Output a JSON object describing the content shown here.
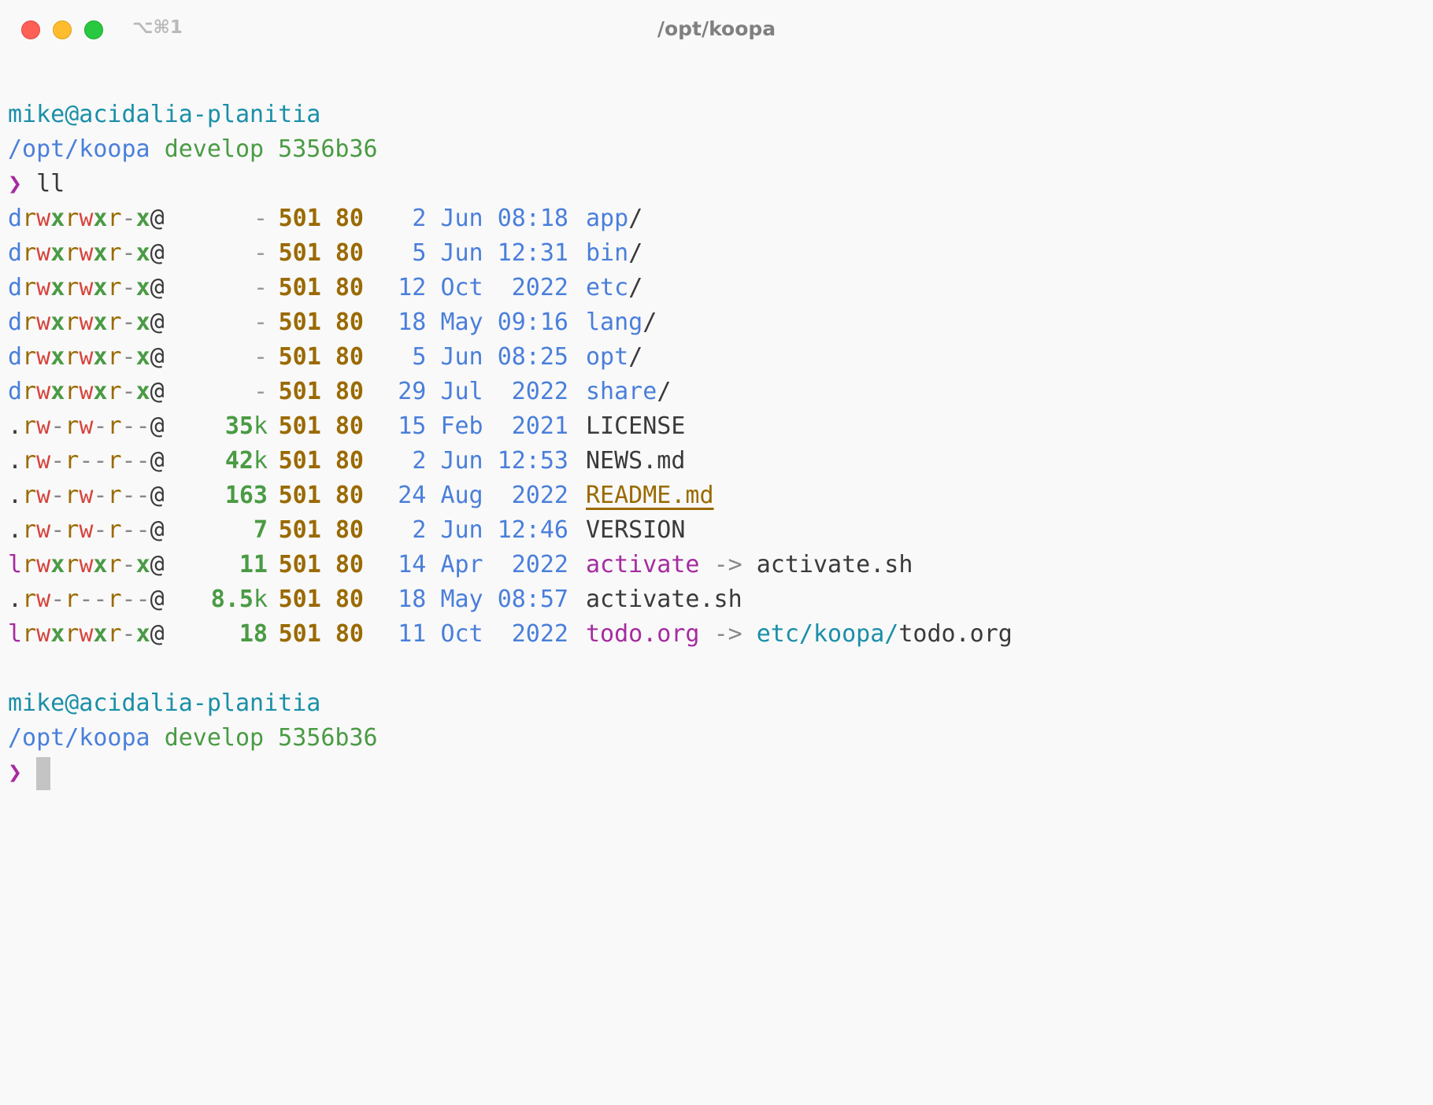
{
  "window": {
    "title": "/opt/koopa",
    "shortcut": "⌥⌘1"
  },
  "colors": {
    "background": "#f9f9f9",
    "text": "#3a3a3a",
    "blue": "#4a7fdb",
    "cyan": "#1a8fa8",
    "green": "#4a9b44",
    "yellow": "#9a6a00",
    "red": "#d6443d",
    "magenta": "#a62ba0"
  },
  "prompt1": {
    "user": "mike@acidalia-planitia",
    "cwd": "/opt/koopa",
    "branch": "develop 5356b36",
    "chevron": "❯",
    "command": "ll"
  },
  "listing": [
    {
      "perm": "drwxrwxr-x@",
      "size": "-",
      "user": "501",
      "group": "80",
      "day": "2",
      "month": "Jun",
      "timeyear": "08:18",
      "name": "app",
      "suffix": "/",
      "kind": "dir"
    },
    {
      "perm": "drwxrwxr-x@",
      "size": "-",
      "user": "501",
      "group": "80",
      "day": "5",
      "month": "Jun",
      "timeyear": "12:31",
      "name": "bin",
      "suffix": "/",
      "kind": "dir"
    },
    {
      "perm": "drwxrwxr-x@",
      "size": "-",
      "user": "501",
      "group": "80",
      "day": "12",
      "month": "Oct",
      "timeyear": "2022",
      "name": "etc",
      "suffix": "/",
      "kind": "dir"
    },
    {
      "perm": "drwxrwxr-x@",
      "size": "-",
      "user": "501",
      "group": "80",
      "day": "18",
      "month": "May",
      "timeyear": "09:16",
      "name": "lang",
      "suffix": "/",
      "kind": "dir"
    },
    {
      "perm": "drwxrwxr-x@",
      "size": "-",
      "user": "501",
      "group": "80",
      "day": "5",
      "month": "Jun",
      "timeyear": "08:25",
      "name": "opt",
      "suffix": "/",
      "kind": "dir"
    },
    {
      "perm": "drwxrwxr-x@",
      "size": "-",
      "user": "501",
      "group": "80",
      "day": "29",
      "month": "Jul",
      "timeyear": "2022",
      "name": "share",
      "suffix": "/",
      "kind": "dir"
    },
    {
      "perm": ".rw-rw-r--@",
      "size": "35k",
      "user": "501",
      "group": "80",
      "day": "15",
      "month": "Feb",
      "timeyear": "2021",
      "name": "LICENSE",
      "kind": "file"
    },
    {
      "perm": ".rw-r--r--@",
      "size": "42k",
      "user": "501",
      "group": "80",
      "day": "2",
      "month": "Jun",
      "timeyear": "12:53",
      "name": "NEWS.md",
      "kind": "file"
    },
    {
      "perm": ".rw-rw-r--@",
      "size": "163",
      "user": "501",
      "group": "80",
      "day": "24",
      "month": "Aug",
      "timeyear": "2022",
      "name": "README.md",
      "kind": "readme"
    },
    {
      "perm": ".rw-rw-r--@",
      "size": "7",
      "user": "501",
      "group": "80",
      "day": "2",
      "month": "Jun",
      "timeyear": "12:46",
      "name": "VERSION",
      "kind": "file"
    },
    {
      "perm": "lrwxrwxr-x@",
      "size": "11",
      "user": "501",
      "group": "80",
      "day": "14",
      "month": "Apr",
      "timeyear": "2022",
      "name": "activate",
      "kind": "link",
      "arrow": "->",
      "target_dir": "",
      "target": "activate.sh"
    },
    {
      "perm": ".rw-r--r--@",
      "size": "8.5k",
      "user": "501",
      "group": "80",
      "day": "18",
      "month": "May",
      "timeyear": "08:57",
      "name": "activate.sh",
      "kind": "file"
    },
    {
      "perm": "lrwxrwxr-x@",
      "size": "18",
      "user": "501",
      "group": "80",
      "day": "11",
      "month": "Oct",
      "timeyear": "2022",
      "name": "todo.org",
      "kind": "link",
      "arrow": "->",
      "target_dir": "etc/koopa/",
      "target": "todo.org"
    }
  ],
  "prompt2": {
    "user": "mike@acidalia-planitia",
    "cwd": "/opt/koopa",
    "branch": "develop 5356b36",
    "chevron": "❯"
  }
}
